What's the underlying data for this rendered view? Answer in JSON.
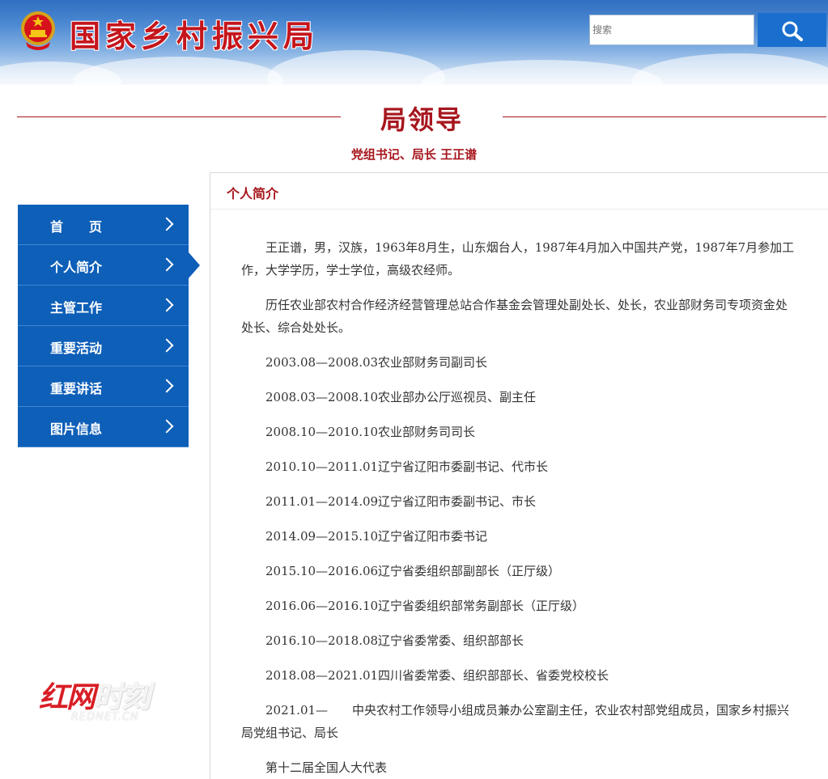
{
  "header": {
    "site_title": "国家乡村振兴局",
    "emblem_icon": "national-emblem-icon",
    "search": {
      "placeholder": "搜索",
      "value": "",
      "button_icon": "search-icon"
    }
  },
  "section": {
    "title": "局领导",
    "leader_line": "党组书记、局长 王正谱"
  },
  "sidebar": {
    "items": [
      {
        "label": "首　　页",
        "active": false
      },
      {
        "label": "个人简介",
        "active": true
      },
      {
        "label": "主管工作",
        "active": false
      },
      {
        "label": "重要活动",
        "active": false
      },
      {
        "label": "重要讲话",
        "active": false
      },
      {
        "label": "图片信息",
        "active": false
      }
    ]
  },
  "content": {
    "heading": "个人简介",
    "paragraphs": [
      "王正谱，男，汉族，1963年8月生，山东烟台人，1987年4月加入中国共产党，1987年7月参加工作，大学学历，学士学位，高级农经师。",
      "历任农业部农村合作经济经营管理总站合作基金会管理处副处长、处长，农业部财务司专项资金处处长、综合处处长。",
      "2003.08—2008.03农业部财务司副司长",
      "2008.03—2008.10农业部办公厅巡视员、副主任",
      "2008.10—2010.10农业部财务司司长",
      "2010.10—2011.01辽宁省辽阳市委副书记、代市长",
      "2011.01—2014.09辽宁省辽阳市委副书记、市长",
      "2014.09—2015.10辽宁省辽阳市委书记",
      "2015.10—2016.06辽宁省委组织部副部长（正厅级）",
      "2016.06—2016.10辽宁省委组织部常务副部长（正厅级）",
      "2016.10—2018.08辽宁省委常委、组织部部长",
      "2018.08—2021.01四川省委常委、组织部部长、省委党校校长",
      "2021.01—　　中央农村工作领导小组成员兼办公室副主任，农业农村部党组成员，国家乡村振兴局党组书记、局长",
      "第十二届全国人大代表"
    ]
  },
  "watermark": {
    "main_red": "红网",
    "main_light": "时刻",
    "sub": "REDNET.CN"
  },
  "colors": {
    "accent_red": "#a7161d",
    "nav_blue": "#0e5fb8",
    "search_blue": "#1a6fce"
  }
}
